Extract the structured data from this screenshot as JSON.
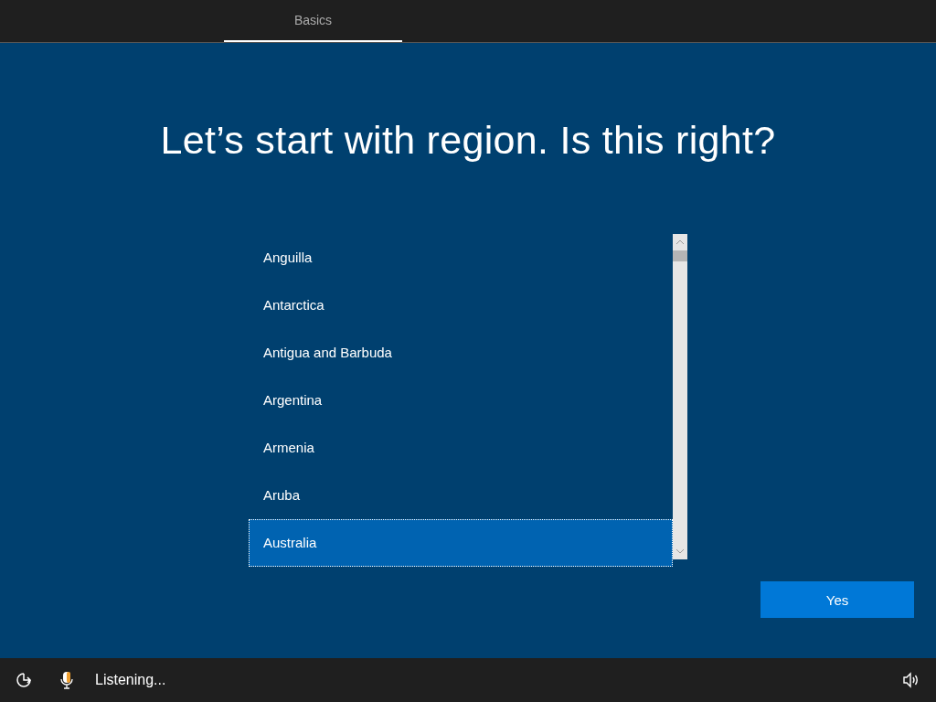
{
  "tabs": [
    {
      "label": "Basics",
      "selected": true
    }
  ],
  "title": "Let’s start with region. Is this right?",
  "regions": [
    {
      "label": "Anguilla",
      "selected": false
    },
    {
      "label": "Antarctica",
      "selected": false
    },
    {
      "label": "Antigua and Barbuda",
      "selected": false
    },
    {
      "label": "Argentina",
      "selected": false
    },
    {
      "label": "Armenia",
      "selected": false
    },
    {
      "label": "Aruba",
      "selected": false
    },
    {
      "label": "Australia",
      "selected": true
    }
  ],
  "primary_button": "Yes",
  "status_bar": {
    "speech_status": "Listening..."
  }
}
